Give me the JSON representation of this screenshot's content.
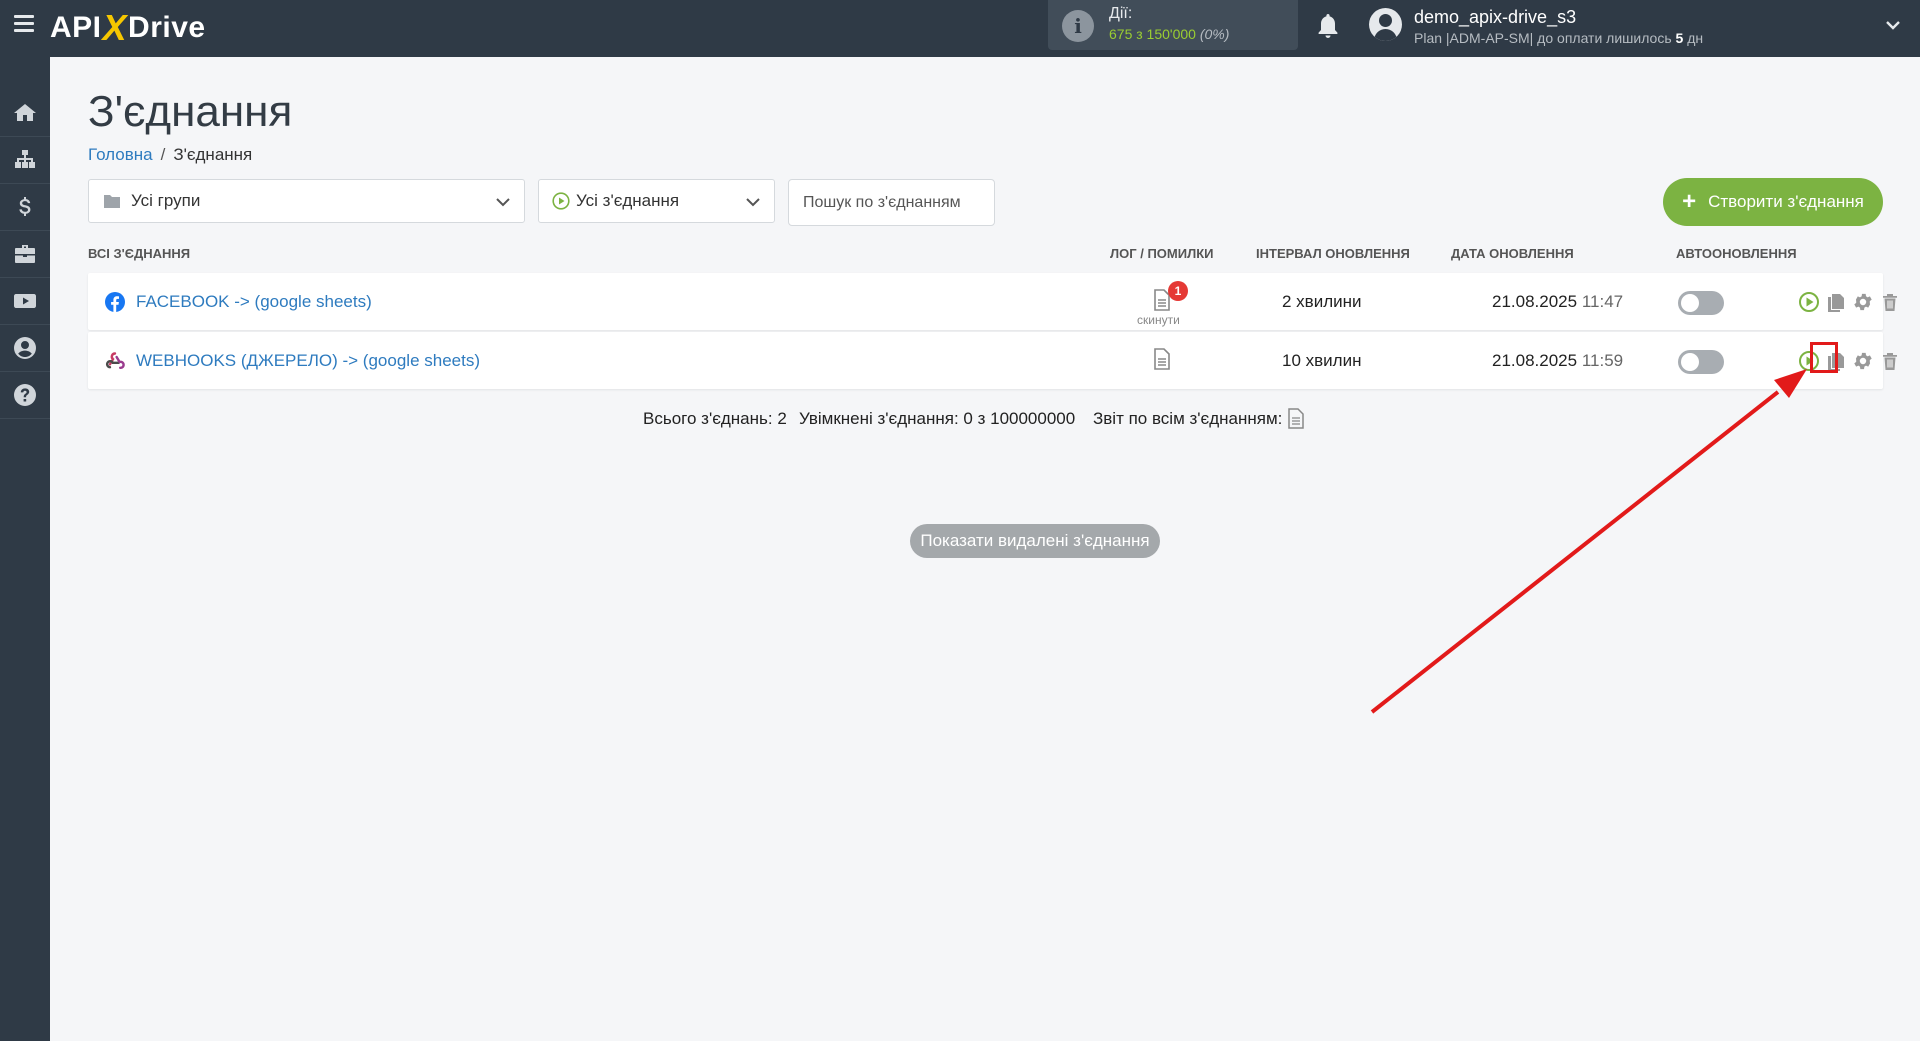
{
  "header": {
    "logo": {
      "api": "API",
      "x": "X",
      "drive": "Drive"
    },
    "actions": {
      "label": "Дії:",
      "value": "675 з 150'000",
      "percent": "(0%)"
    },
    "user": {
      "name": "demo_apix-drive_s3",
      "plan_prefix": "Plan |ADM-AP-SM| до оплати лишилось ",
      "days": "5",
      "plan_suffix": " дн"
    }
  },
  "sidebar": {
    "items": [
      {
        "icon": "home-icon"
      },
      {
        "icon": "sitemap-icon"
      },
      {
        "icon": "dollar-icon"
      },
      {
        "icon": "briefcase-icon"
      },
      {
        "icon": "youtube-icon"
      },
      {
        "icon": "user-icon"
      },
      {
        "icon": "help-icon"
      }
    ]
  },
  "page": {
    "title": "З'єднання",
    "breadcrumb": {
      "home": "Головна",
      "sep": "/",
      "current": "З'єднання"
    }
  },
  "filters": {
    "group_select": "Усі групи",
    "status_select": "Усі з'єднання",
    "search_placeholder": "Пошук по з'єднанням",
    "create_button": "Створити з'єднання"
  },
  "table": {
    "headers": {
      "all": "ВСІ З'ЄДНАННЯ",
      "log": "ЛОГ / ПОМИЛКИ",
      "interval": "ІНТЕРВАЛ ОНОВЛЕННЯ",
      "date": "ДАТА ОНОВЛЕННЯ",
      "auto": "АВТООНОВЛЕННЯ"
    },
    "rows": [
      {
        "name": "FACEBOOK -> (google sheets)",
        "icon": "facebook-icon",
        "log_badge": "1",
        "log_reset": "скинути",
        "interval": "2 хвилини",
        "date": "21.08.2025",
        "time": "11:47",
        "auto_update": false
      },
      {
        "name": "WEBHOOKS (ДЖЕРЕЛО) -> (google sheets)",
        "icon": "webhooks-icon",
        "interval": "10 хвилин",
        "date": "21.08.2025",
        "time": "11:59",
        "auto_update": false
      }
    ]
  },
  "footer": {
    "total": "Всього з'єднань: 2",
    "enabled": "Увімкнені з'єднання: 0 з 100000000",
    "report": "Звіт по всім з'єднанням:",
    "show_deleted": "Показати видалені з'єднання"
  },
  "colors": {
    "topbar": "#2f3a46",
    "accent_green": "#7cb342",
    "link_blue": "#2e7bbf",
    "annotation_red": "#e21a1a"
  }
}
